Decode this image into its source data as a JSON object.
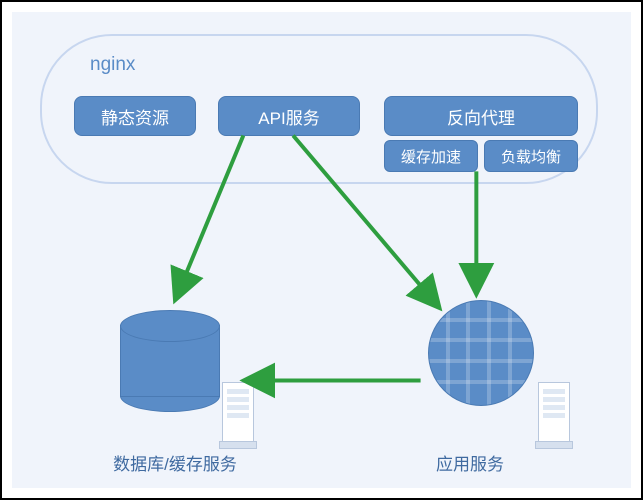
{
  "diagram": {
    "title": "nginx",
    "modules": {
      "static_resources": "静态资源",
      "api_service": "API服务",
      "reverse_proxy": "反向代理",
      "cache_accel": "缓存加速",
      "load_balance": "负载均衡"
    },
    "nodes": {
      "database": "数据库/缓存服务",
      "app_server": "应用服务"
    },
    "arrows": [
      {
        "from": "api_service",
        "to": "database"
      },
      {
        "from": "api_service",
        "to": "app_server"
      },
      {
        "from": "reverse_proxy",
        "to": "app_server"
      },
      {
        "from": "app_server",
        "to": "database"
      }
    ],
    "colors": {
      "box_fill": "#5a8cc7",
      "box_border": "#4a7ab3",
      "outline": "#c7d6ef",
      "arrow": "#2e9e3f",
      "canvas": "#f0f4fb"
    }
  }
}
